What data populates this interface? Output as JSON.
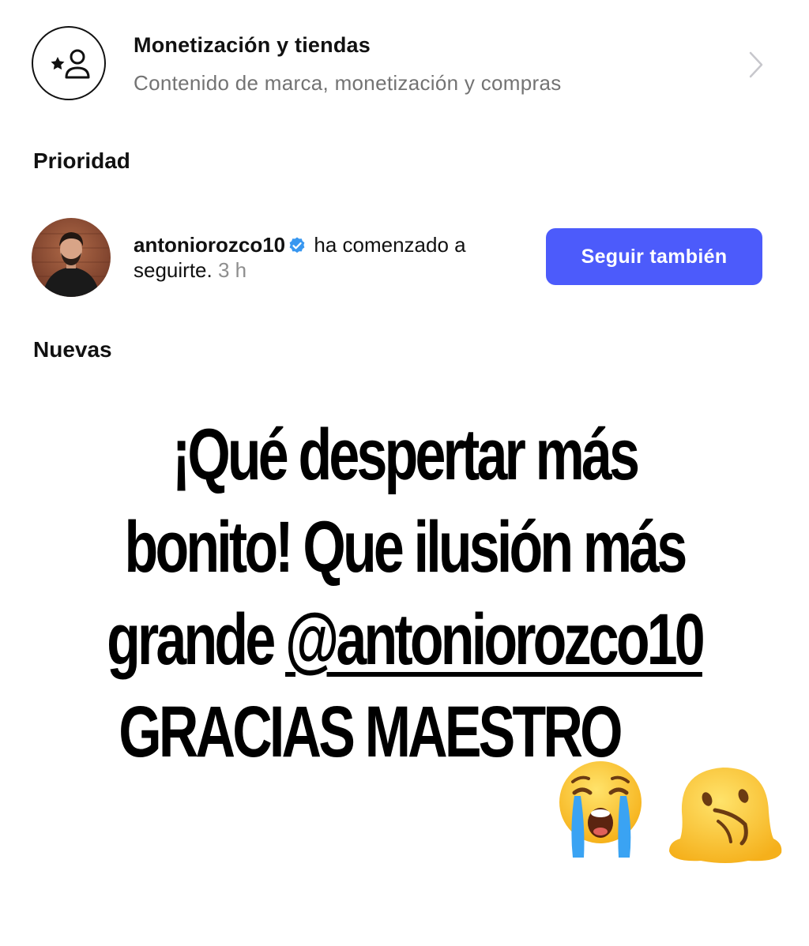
{
  "monetization": {
    "icon": "star-person-icon",
    "title": "Monetización y tiendas",
    "subtitle": "Contenido de marca, monetización y compras",
    "chevron_icon": "chevron-right-icon"
  },
  "sections": {
    "priority_title": "Prioridad",
    "new_title": "Nuevas"
  },
  "notification": {
    "username": "antoniorozco10",
    "verified_icon": "verified-badge-icon",
    "verified_color": "#3897f0",
    "message": " ha comenzado a seguirte.",
    "time": " 3 h",
    "button_label": "Seguir también",
    "button_color": "#4c5bfb"
  },
  "caption": {
    "line1": "¡Qué despertar más",
    "line2": "bonito! Que ilusión más",
    "line3_prefix": "grande ",
    "mention": "@antoniorozco10",
    "line4": "GRACIAS MAESTRO",
    "emojis": [
      "crying-face-emoji",
      "melting-face-emoji"
    ]
  }
}
